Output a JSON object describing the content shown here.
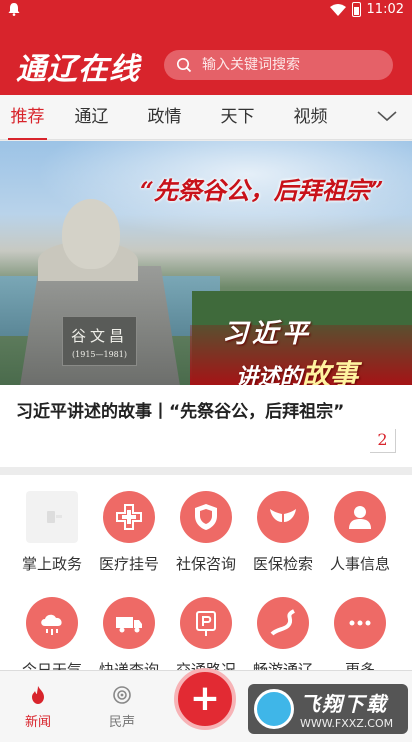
{
  "status_bar": {
    "time": "11:02"
  },
  "header": {
    "logo_text": "通辽在线",
    "search_placeholder": "输入关键词搜索"
  },
  "tabs": [
    {
      "label": "推荐",
      "active": true
    },
    {
      "label": "通辽",
      "active": false
    },
    {
      "label": "政情",
      "active": false
    },
    {
      "label": "天下",
      "active": false
    },
    {
      "label": "视频",
      "active": false
    }
  ],
  "banner": {
    "headline": "“先祭谷公，后拜祖宗”",
    "series_line1": "习近平",
    "series_line2_prefix": "讲述的",
    "series_line2_big": "故事",
    "plaque_text": "谷文昌",
    "plaque_years": "(1915—1981)"
  },
  "article": {
    "title": "习近平讲述的故事丨“先祭谷公，后拜祖宗”",
    "page_number": "2"
  },
  "services": [
    {
      "label": "掌上政务",
      "icon": "app-icon"
    },
    {
      "label": "医疗挂号",
      "icon": "medical-cross-icon"
    },
    {
      "label": "社保咨询",
      "icon": "shield-icon"
    },
    {
      "label": "医保检索",
      "icon": "wings-icon"
    },
    {
      "label": "人事信息",
      "icon": "person-icon"
    },
    {
      "label": "今日天气",
      "icon": "weather-icon"
    },
    {
      "label": "快递查询",
      "icon": "truck-icon"
    },
    {
      "label": "交通路况",
      "icon": "parking-icon"
    },
    {
      "label": "畅游通辽",
      "icon": "road-icon"
    },
    {
      "label": "更多",
      "icon": "more-icon"
    }
  ],
  "bottom_nav": [
    {
      "label": "新闻",
      "icon": "flame-icon",
      "active": true
    },
    {
      "label": "民声",
      "icon": "voice-icon",
      "active": false
    }
  ],
  "watermark": {
    "title": "飞翔下载",
    "url": "WWW.FXXZ.COM"
  },
  "colors": {
    "brand_red": "#d8242c",
    "service_red": "#ee6a66"
  }
}
